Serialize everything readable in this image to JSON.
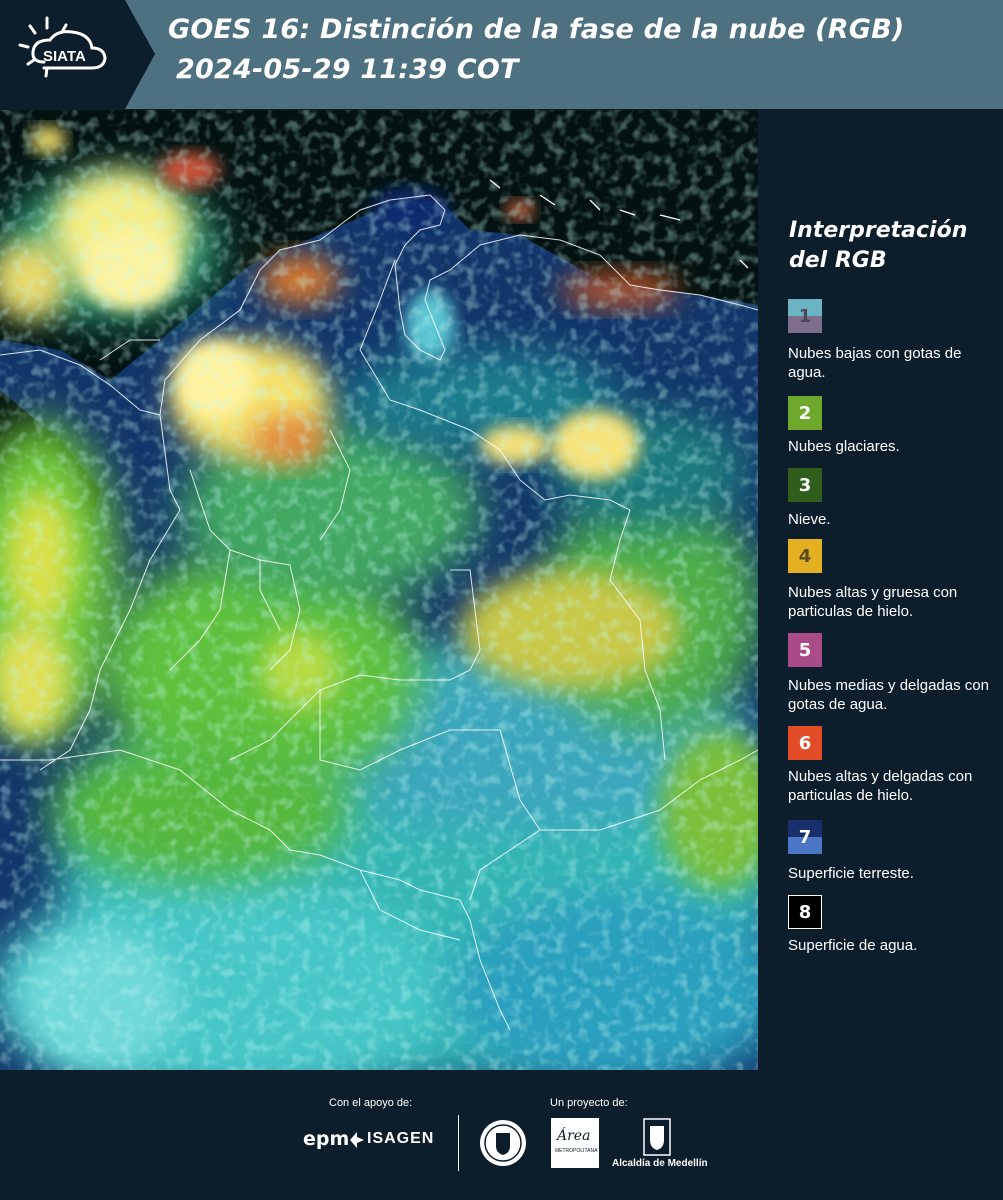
{
  "header": {
    "title_line1": "GOES 16: Distinción de la fase de la nube (RGB)",
    "title_line2": "2024-05-29 11:39 COT",
    "logo_text": "SIATA",
    "background": "#4d7180",
    "logo_tab_color": "#0c1d2b"
  },
  "legend": {
    "title": "Interpretación del RGB",
    "items": [
      {
        "num": "1",
        "label": "Nubes bajas con gotas de agua.",
        "colors": [
          "#6bb4c4",
          "#7e6d8b"
        ]
      },
      {
        "num": "2",
        "label": "Nubes glaciares.",
        "colors": [
          "#6ea82c"
        ]
      },
      {
        "num": "3",
        "label": "Nieve.",
        "colors": [
          "#2f5d1b"
        ]
      },
      {
        "num": "4",
        "label": "Nubes altas y gruesa con particulas de hielo.",
        "colors": [
          "#e3b021"
        ]
      },
      {
        "num": "5",
        "label": "Nubes medias y delgadas con gotas de agua.",
        "colors": [
          "#a84b86"
        ]
      },
      {
        "num": "6",
        "label": "Nubes altas y delgadas con particulas de hielo.",
        "colors": [
          "#e24c26"
        ]
      },
      {
        "num": "7",
        "label": "Superficie terreste.",
        "colors": [
          "#182f6c",
          "#4a76c5"
        ]
      },
      {
        "num": "8",
        "label": "Superficie de agua.",
        "colors": [
          "#000000"
        ]
      }
    ]
  },
  "footer": {
    "support_label": "Con el apoyo de:",
    "project_label": "Un proyecto de:",
    "sponsors": [
      "epm",
      "ISAGEN"
    ],
    "partners": [
      "Área Metropolitana Valle de Aburrá",
      "Alcaldía de Medellín"
    ],
    "alcaldia_text": "Alcaldía de Medellín",
    "area_text": "Área",
    "area_sub": "METROPOLITANA"
  },
  "map": {
    "product": "GOES 16 RGB",
    "colors": {
      "ocean": "#031211",
      "land_clear": "#123a73",
      "low_cloud": "#3fb8b0",
      "ice_cloud": "#9fd83a",
      "thick_ice": "#f4e46a",
      "thin_ice": "#e05a2a",
      "border": "#ffffff"
    }
  }
}
